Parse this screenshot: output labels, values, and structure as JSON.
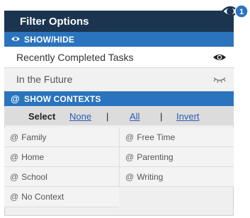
{
  "header": {
    "title": "Filter Options",
    "badge_count": "1"
  },
  "show_hide": {
    "label": "SHOW/HIDE",
    "items": [
      {
        "label": "Recently Completed Tasks",
        "icon": "eye-open-icon"
      },
      {
        "label": "In the Future",
        "icon": "eye-closed-icon"
      }
    ]
  },
  "contexts": {
    "label": "SHOW CONTEXTS",
    "select": {
      "label": "Select",
      "none": "None",
      "sep": "|",
      "all": "All",
      "invert": "Invert"
    },
    "items": [
      "Family",
      "Free Time",
      "Home",
      "Parenting",
      "School",
      "Writing",
      "No Context"
    ],
    "at_symbol": "@"
  },
  "colors": {
    "header_bg": "#1b3550",
    "section_bg": "#2a74bd",
    "badge_bg": "#2a74bd",
    "link": "#2a5db0"
  }
}
